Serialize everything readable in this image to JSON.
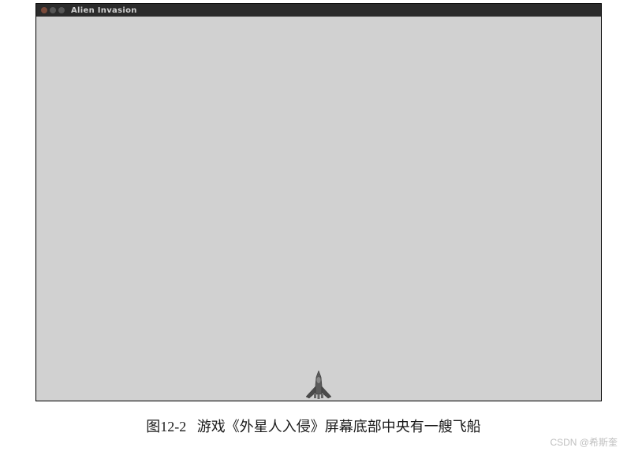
{
  "titlebar": {
    "title": "Alien Invasion"
  },
  "caption": {
    "label": "图12-2",
    "text": "游戏《外星人入侵》屏幕底部中央有一艘飞船"
  },
  "watermark": {
    "text": "CSDN @希斯奎"
  },
  "ship": {
    "name": "player-ship"
  }
}
